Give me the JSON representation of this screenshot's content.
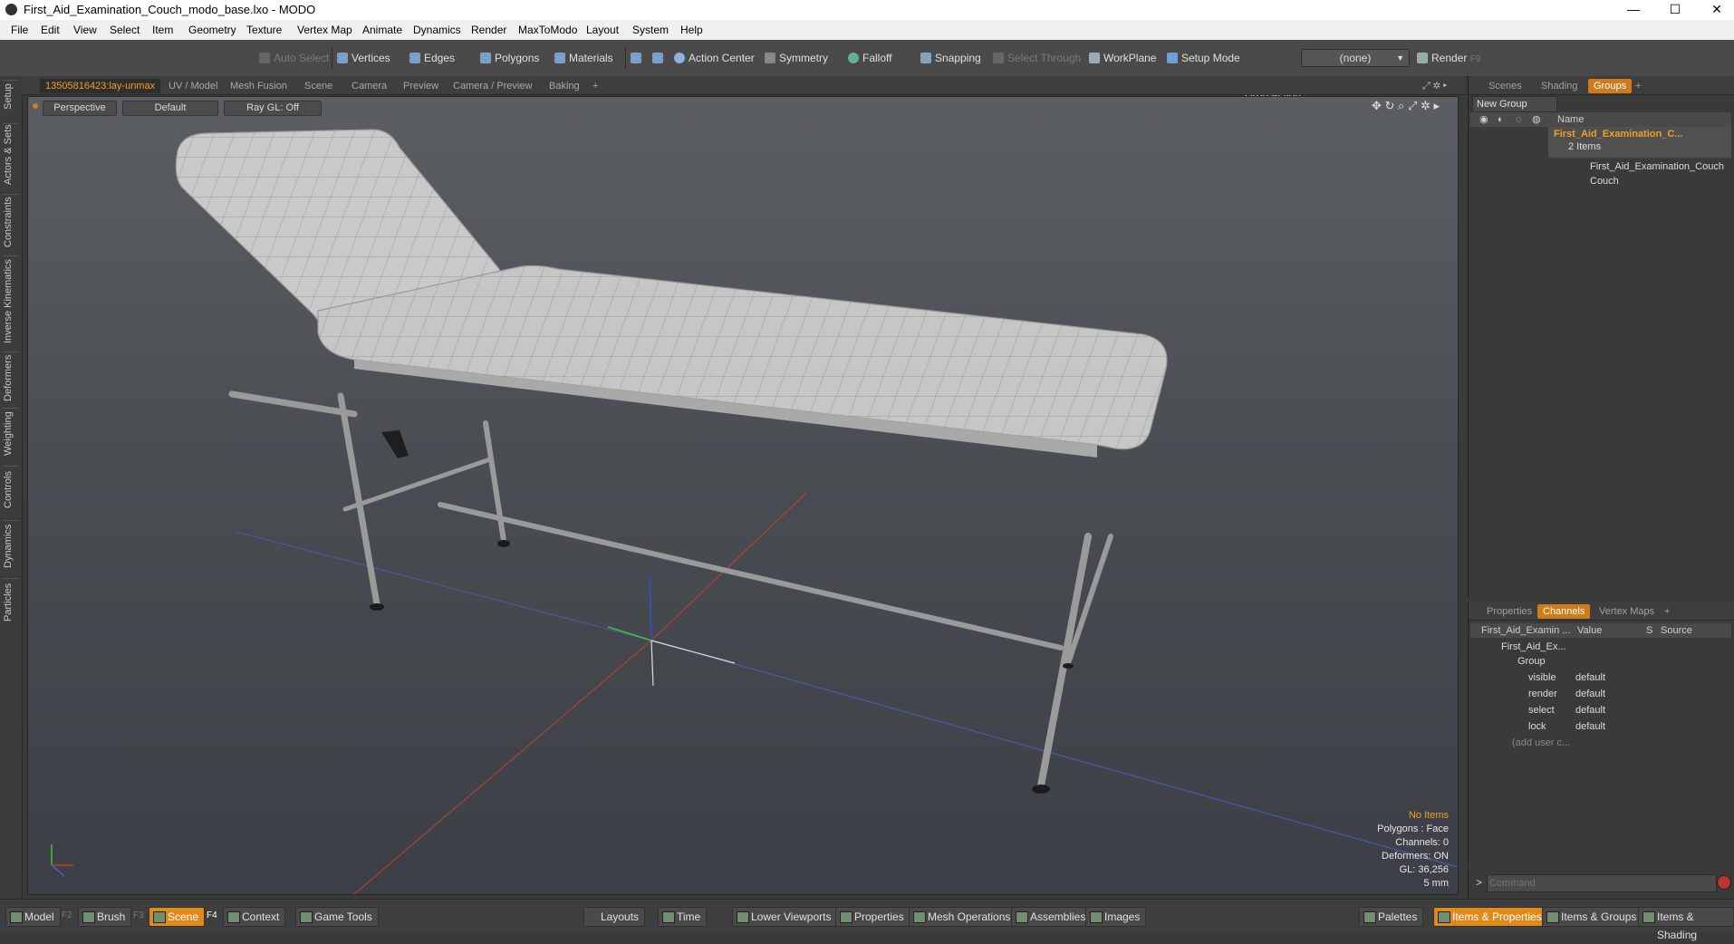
{
  "window": {
    "title": "First_Aid_Examination_Couch_modo_base.lxo - MODO",
    "minimize": "—",
    "maximize": "☐",
    "close": "✕"
  },
  "menu": [
    "File",
    "Edit",
    "View",
    "Select",
    "Item",
    "Geometry",
    "Texture",
    "Vertex Map",
    "Animate",
    "Dynamics",
    "Render",
    "MaxToModo",
    "Layout",
    "System",
    "Help"
  ],
  "toolbar": {
    "auto_select": "Auto Select",
    "vertices": "Vertices",
    "edges": "Edges",
    "polygons": "Polygons",
    "materials": "Materials",
    "action_center": "Action Center",
    "symmetry": "Symmetry",
    "falloff": "Falloff",
    "snapping": "Snapping",
    "select_through": "Select Through",
    "workplane": "WorkPlane",
    "setup_mode": "Setup Mode",
    "drop_action_label": "Drop Action",
    "drop_action_value": "(none)",
    "render": "Render",
    "render_key": "F9"
  },
  "left_tabs": [
    "Setup",
    "Actors & Sets",
    "Constraints",
    "Inverse Kinematics",
    "Deformers",
    "Weighting",
    "Controls",
    "Dynamics",
    "Particles"
  ],
  "viewport_tabs": [
    "13505816423:lay-unmax",
    "UV / Model",
    "Mesh Fusion",
    "Scene",
    "Camera",
    "Preview",
    "Camera / Preview",
    "Baking",
    "+"
  ],
  "viewport": {
    "projection": "Perspective",
    "shading": "Default",
    "raygl": "Ray GL: Off"
  },
  "hud": {
    "items": "No Items",
    "polygons": "Polygons : Face",
    "channels": "Channels: 0",
    "deformers": "Deformers: ON",
    "gl": "GL: 36,256",
    "unit": "5 mm"
  },
  "scene_panel": {
    "tabs": [
      "Scenes",
      "Shading",
      "Groups",
      "+"
    ],
    "new_group": "New Group",
    "name_header": "Name",
    "group_name": "First_Aid_Examination_C...",
    "group_count": "2 Items",
    "children": [
      "First_Aid_Examination_Couch",
      "Couch"
    ]
  },
  "channels_panel": {
    "tabs": [
      "Properties",
      "Channels",
      "Vertex Maps",
      "+"
    ],
    "headers": {
      "name": "First_Aid_Examin ...",
      "value": "Value",
      "s": "S",
      "source": "Source"
    },
    "root": "First_Aid_Ex...",
    "group": "Group",
    "rows": [
      {
        "name": "visible",
        "value": "default"
      },
      {
        "name": "render",
        "value": "default"
      },
      {
        "name": "select",
        "value": "default"
      },
      {
        "name": "lock",
        "value": "default"
      }
    ],
    "add_user": "(add user c..."
  },
  "command": {
    "prompt": ">",
    "placeholder": "Command"
  },
  "bottom": {
    "left": [
      {
        "label": "Model",
        "key": "F2"
      },
      {
        "label": "Brush",
        "key": "F3"
      },
      {
        "label": "Scene",
        "key": "F4"
      },
      {
        "label": "Context",
        "key": ""
      },
      {
        "label": "Game Tools",
        "key": ""
      }
    ],
    "center": [
      "Layouts",
      "Time",
      "Lower Viewports",
      "Properties",
      "Mesh Operations",
      "Assemblies",
      "Images"
    ],
    "right": [
      "Palettes",
      "Items & Properties",
      "Items & Groups",
      "Items & Shading"
    ]
  },
  "colors": {
    "accent": "#e08a1a",
    "group_text": "#f0a020"
  }
}
